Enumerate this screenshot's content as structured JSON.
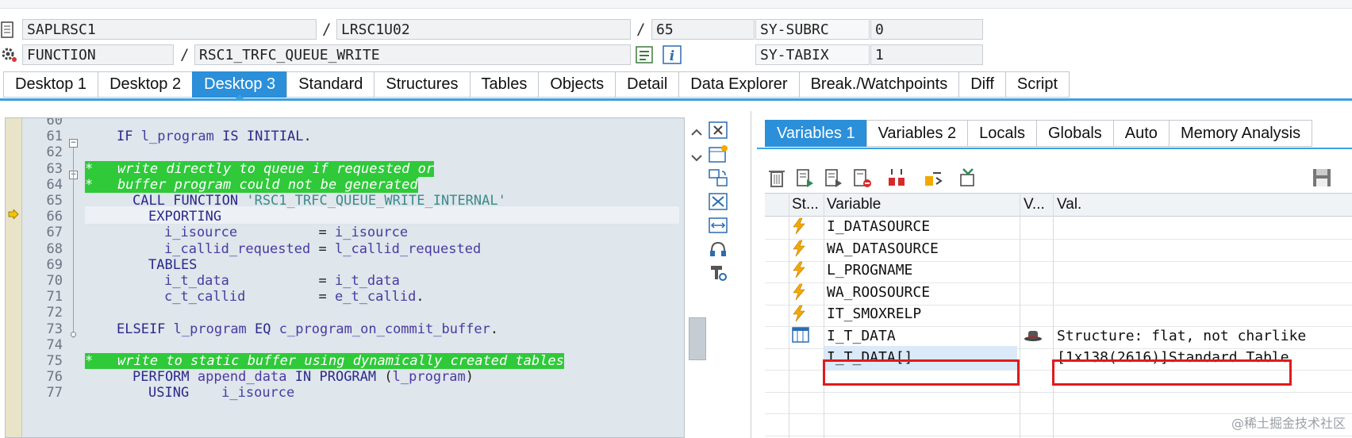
{
  "header": {
    "program": "SAPLRSC1",
    "include": "LRSC1U02",
    "line": "65",
    "type": "FUNCTION",
    "name": "RSC1_TRFC_QUEUE_WRITE",
    "sys1_label": "SY-SUBRC",
    "sys1_value": "0",
    "sys2_label": "SY-TABIX",
    "sys2_value": "1",
    "separator": "/"
  },
  "tabs": [
    "Desktop 1",
    "Desktop 2",
    "Desktop 3",
    "Standard",
    "Structures",
    "Tables",
    "Objects",
    "Detail",
    "Data Explorer",
    "Break./Watchpoints",
    "Diff",
    "Script"
  ],
  "active_tab": "Desktop 3",
  "code_lines": [
    {
      "n": "60",
      "t": ""
    },
    {
      "n": "61",
      "t": "IF l_program IS INITIAL."
    },
    {
      "n": "62",
      "t": ""
    },
    {
      "n": "63",
      "t": "*   write directly to queue if requested or"
    },
    {
      "n": "64",
      "t": "*   buffer program could not be generated"
    },
    {
      "n": "65",
      "t": "CALL FUNCTION 'RSC1_TRFC_QUEUE_WRITE_INTERNAL'"
    },
    {
      "n": "66",
      "t": "EXPORTING"
    },
    {
      "n": "67",
      "t": "i_isource          = i_isource"
    },
    {
      "n": "68",
      "t": "i_callid_requested = l_callid_requested"
    },
    {
      "n": "69",
      "t": "TABLES"
    },
    {
      "n": "70",
      "t": "i_t_data           = i_t_data"
    },
    {
      "n": "71",
      "t": "c_t_callid         = e_t_callid."
    },
    {
      "n": "72",
      "t": ""
    },
    {
      "n": "73",
      "t": "ELSEIF l_program EQ c_program_on_commit_buffer."
    },
    {
      "n": "74",
      "t": ""
    },
    {
      "n": "75",
      "t": "*   write to static buffer using dynamically created tables"
    },
    {
      "n": "76",
      "t": "PERFORM append_data IN PROGRAM (l_program)"
    },
    {
      "n": "77",
      "t": "USING    i_isource"
    }
  ],
  "var_tabs": [
    "Variables 1",
    "Variables 2",
    "Locals",
    "Globals",
    "Auto",
    "Memory Analysis"
  ],
  "active_var_tab": "Variables 1",
  "grid": {
    "headers": {
      "status": "St...",
      "variable": "Variable",
      "v": "V...",
      "value": "Val."
    },
    "rows": [
      {
        "icon": "lightning-icon",
        "variable": "I_DATASOURCE",
        "v": "",
        "value": ""
      },
      {
        "icon": "lightning-icon",
        "variable": "WA_DATASOURCE",
        "v": "",
        "value": ""
      },
      {
        "icon": "lightning-icon",
        "variable": "L_PROGNAME",
        "v": "",
        "value": ""
      },
      {
        "icon": "lightning-icon",
        "variable": "WA_ROOSOURCE",
        "v": "",
        "value": ""
      },
      {
        "icon": "lightning-icon",
        "variable": "IT_SMOXRELP",
        "v": "",
        "value": ""
      },
      {
        "icon": "table-icon",
        "variable": "I_T_DATA",
        "v": "hat-icon",
        "value": "Structure: flat, not charlike"
      },
      {
        "icon": "",
        "variable": "I_T_DATA[]",
        "v": "",
        "value": "[1x138(2616)]Standard Table"
      }
    ]
  },
  "watermark": "@稀土掘金技术社区",
  "colors": {
    "accent": "#2b8fd9",
    "comment_bg": "#2fc93a",
    "highlight": "#e01b1b"
  }
}
